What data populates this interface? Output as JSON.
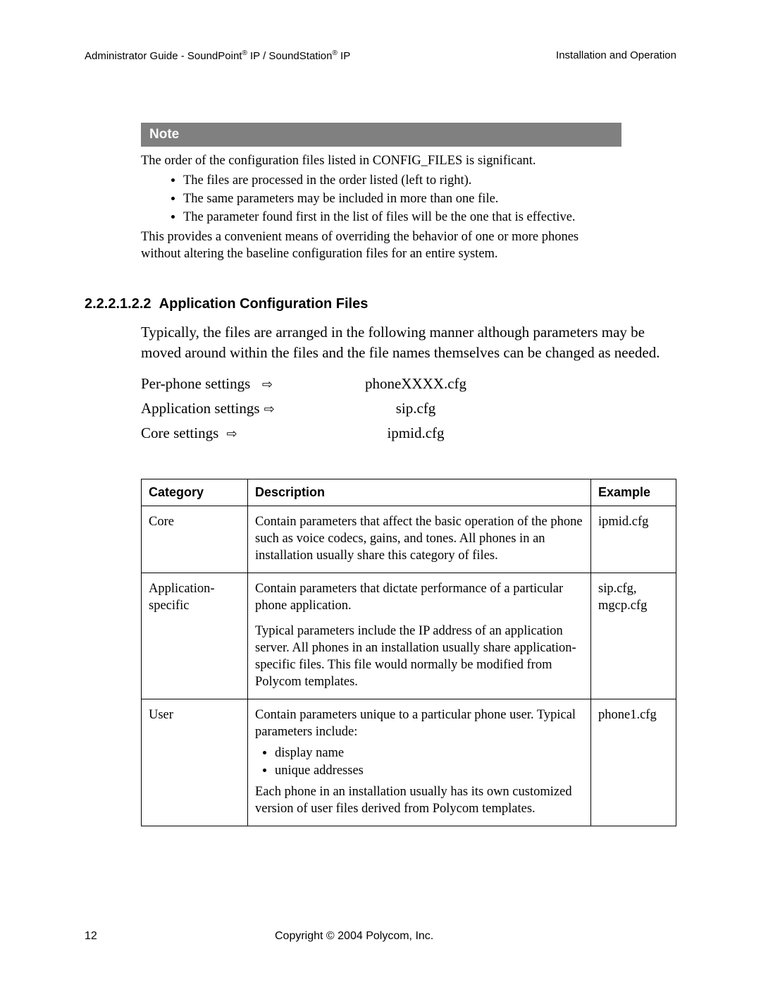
{
  "header": {
    "left_prefix": "Administrator Guide - SoundPoint",
    "left_mid": " IP / SoundStation",
    "left_suffix": " IP",
    "right": "Installation and Operation"
  },
  "note": {
    "title": "Note",
    "intro": "The order of the configuration files listed in CONFIG_FILES is significant.",
    "bullets": [
      "The files are processed in the order listed (left to right).",
      "The same parameters may be included in more than one file.",
      "The parameter found first in the list of files will be the one that is effective."
    ],
    "outro": "This provides a convenient means of overriding the behavior of one or more phones without altering the baseline configuration files for an entire system."
  },
  "section": {
    "number": "2.2.2.1.2.2",
    "title": "Application Configuration Files",
    "paragraph": "Typically, the files are arranged in the following manner although parameters may be moved around within the files and the file names themselves can be changed as needed."
  },
  "settings": [
    {
      "label": "Per-phone settings",
      "value": "phoneXXXX.cfg"
    },
    {
      "label": "Application settings",
      "value": "sip.cfg"
    },
    {
      "label": "Core settings",
      "value": "ipmid.cfg"
    }
  ],
  "table": {
    "headers": {
      "category": "Category",
      "description": "Description",
      "example": "Example"
    },
    "rows": [
      {
        "category": "Core",
        "desc_p1": "Contain parameters that affect the basic operation of the phone such as voice codecs, gains, and tones.  All phones in an installation usually share this category of files.",
        "example": "ipmid.cfg"
      },
      {
        "category": "Application-specific",
        "desc_p1": "Contain parameters that dictate performance of a particular phone application.",
        "desc_p2": "Typical parameters include the IP address of an application server.  All phones in an installation usually share application-specific files.  This file would normally be modified from Polycom templates.",
        "example": "sip.cfg, mgcp.cfg"
      },
      {
        "category": "User",
        "desc_p1": "Contain parameters unique to a particular phone user.  Typical parameters include:",
        "desc_li1": "display name",
        "desc_li2": "unique addresses",
        "desc_p2": "Each phone in an installation usually has its own customized version of user files derived from Polycom templates.",
        "example": "phone1.cfg"
      }
    ]
  },
  "footer": {
    "page": "12",
    "copyright": "Copyright © 2004 Polycom, Inc."
  },
  "arrow_glyph": "⇨"
}
